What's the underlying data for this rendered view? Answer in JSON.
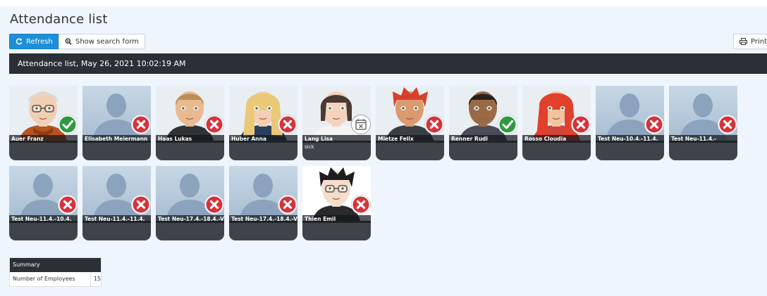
{
  "page": {
    "title": "Attendance list"
  },
  "toolbar": {
    "refresh_label": "Refresh",
    "search_label": "Show search form",
    "print_label": "Print"
  },
  "list": {
    "header": "Attendance list, May 26, 2021 10:02:19 AM"
  },
  "employees": [
    {
      "name": "Auer Franz",
      "status": "present",
      "avatar": "elder-man",
      "note": ""
    },
    {
      "name": "Elisabeth Meiermann",
      "status": "absent",
      "avatar": "placeholder",
      "note": ""
    },
    {
      "name": "Haas Lukas",
      "status": "absent",
      "avatar": "blond-man",
      "note": ""
    },
    {
      "name": "Huber Anna",
      "status": "absent",
      "avatar": "blonde-woman",
      "note": ""
    },
    {
      "name": "Lang Lisa",
      "status": "sick",
      "avatar": "brunette-woman",
      "note": "sick"
    },
    {
      "name": "Mietze Felix",
      "status": "absent",
      "avatar": "redhead-man",
      "note": ""
    },
    {
      "name": "Renner Rudi",
      "status": "present",
      "avatar": "dark-man",
      "note": ""
    },
    {
      "name": "Rosso Cloudia",
      "status": "absent",
      "avatar": "redhead-woman",
      "note": ""
    },
    {
      "name": "Test Neu-10.4.-11.4.",
      "status": "absent",
      "avatar": "placeholder",
      "note": ""
    },
    {
      "name": "Test Neu-11.4.-",
      "status": "absent",
      "avatar": "placeholder",
      "note": ""
    },
    {
      "name": "Test Neu-11.4.-10.4.",
      "status": "absent",
      "avatar": "placeholder",
      "note": ""
    },
    {
      "name": "Test Neu-11.4.-11.4.",
      "status": "absent",
      "avatar": "placeholder",
      "note": ""
    },
    {
      "name": "Test Neu-17.4.-18.4.-V",
      "status": "absent",
      "avatar": "placeholder",
      "note": ""
    },
    {
      "name": "Test Neu-17.4.-18.4.-V",
      "status": "absent",
      "avatar": "placeholder",
      "note": ""
    },
    {
      "name": "Thien Emil",
      "status": "absent",
      "avatar": "glasses-man",
      "note": ""
    }
  ],
  "summary": {
    "title": "Summary",
    "rows": [
      {
        "label": "Number of Employees",
        "value": "15"
      }
    ]
  },
  "colors": {
    "primary": "#1e8fd6",
    "dark": "#2b3036",
    "present": "#2e9a3e",
    "absent": "#d6333b",
    "background": "#eef5fd"
  }
}
